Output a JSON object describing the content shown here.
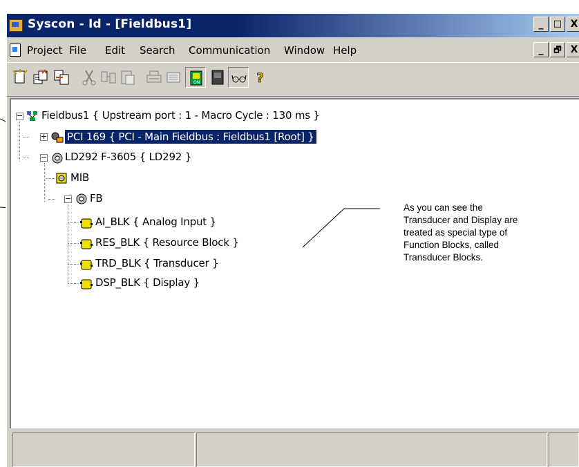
{
  "window": {
    "title": "Syscon - Id - [Fieldbus1]",
    "caption_buttons": [
      "_",
      "□",
      "X"
    ]
  },
  "menubar": {
    "items": [
      "Project",
      "File",
      "Edit",
      "Search",
      "Communication",
      "Window",
      "Help"
    ],
    "mdi_buttons": [
      "_",
      "🗗",
      "X"
    ]
  },
  "toolbar": {
    "buttons": [
      "new-icon",
      "open-icon",
      "save-icon",
      "cut-icon",
      "copy-icon",
      "paste-icon",
      "print-icon",
      "preview-icon",
      "online-icon",
      "offline-icon",
      "glasses-icon",
      "help-icon"
    ]
  },
  "tree": {
    "root": "Fieldbus1 { Upstream port : 1 - Macro Cycle : 130 ms }",
    "bridge": "PCI 169 { PCI - Main Fieldbus : Fieldbus1 [Root] }",
    "device": "LD292 F-3605 { LD292 }",
    "mib": "MIB",
    "fb": "FB",
    "blocks": [
      "AI_BLK { Analog Input }",
      "RES_BLK { Resource Block }",
      "TRD_BLK { Transducer }",
      "DSP_BLK { Display }"
    ]
  },
  "note": {
    "lines": [
      "As you can see the",
      "Transducer and Display are",
      "treated as special type of",
      "Function Blocks, called",
      "Transducer Blocks."
    ]
  },
  "colors": {
    "title_active": "#0a246a",
    "face": "#d4d0c8",
    "selection": "#0a246a",
    "block_yellow": "#f0e000"
  }
}
